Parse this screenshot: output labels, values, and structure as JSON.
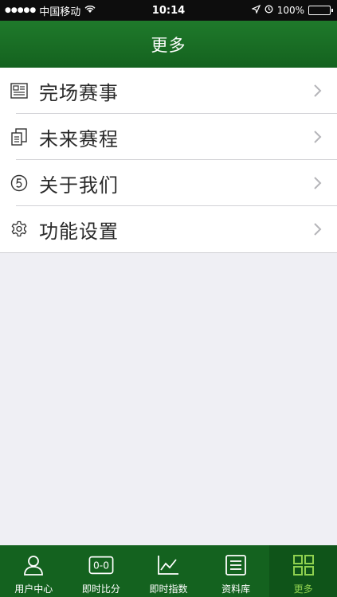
{
  "status_bar": {
    "signal": "●●●●●",
    "carrier": "中国移动",
    "time": "10:14",
    "battery_text": "100%"
  },
  "nav": {
    "title": "更多"
  },
  "menu": {
    "items": [
      {
        "label": "完场赛事",
        "icon": "newspaper-icon"
      },
      {
        "label": "未来赛程",
        "icon": "documents-icon"
      },
      {
        "label": "关于我们",
        "icon": "circled-five-icon"
      },
      {
        "label": "功能设置",
        "icon": "gear-icon"
      }
    ]
  },
  "tabs": [
    {
      "label": "用户中心",
      "icon": "user-icon",
      "active": false
    },
    {
      "label": "即时比分",
      "icon": "score-icon",
      "icon_text": "0-0",
      "active": false
    },
    {
      "label": "即时指数",
      "icon": "chart-icon",
      "active": false
    },
    {
      "label": "资料库",
      "icon": "list-icon",
      "active": false
    },
    {
      "label": "更多",
      "icon": "grid-icon",
      "active": true
    }
  ],
  "colors": {
    "nav_green": "#1a6e25",
    "tab_active_text": "#8fd14f",
    "background": "#efeff4"
  }
}
